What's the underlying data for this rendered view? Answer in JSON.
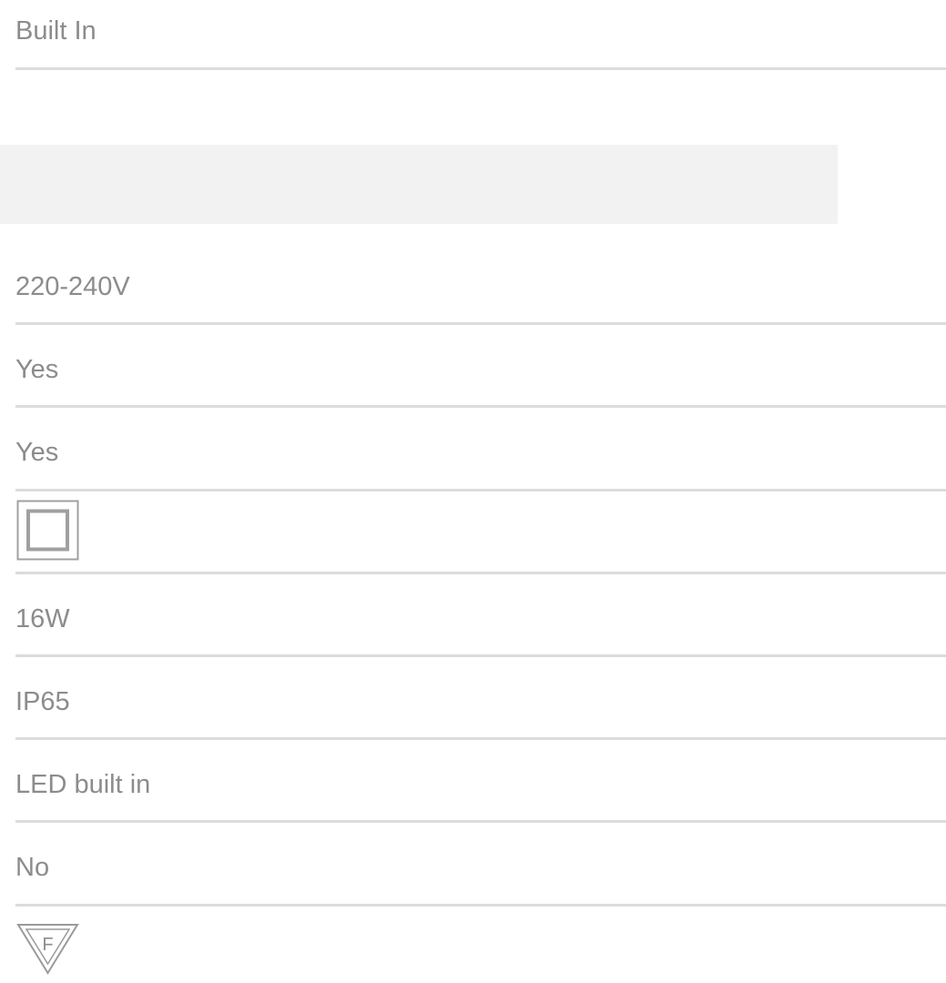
{
  "spec_rows": [
    {
      "value": "Built In"
    },
    {
      "value": "220-240V"
    },
    {
      "value": "Yes"
    },
    {
      "value": "Yes"
    },
    {
      "icon": "class-ii-double-insulation-icon"
    },
    {
      "value": "16W"
    },
    {
      "value": "IP65"
    },
    {
      "value": "LED built in"
    },
    {
      "value": "No"
    },
    {
      "icon": "f-mark-triangle-icon"
    }
  ],
  "triangle_icon_letter": "F",
  "colors": {
    "text": "#8c8c8c",
    "divider": "#dcdcdc",
    "band": "#f2f2f2",
    "icon_stroke": "#9a9a9a"
  }
}
